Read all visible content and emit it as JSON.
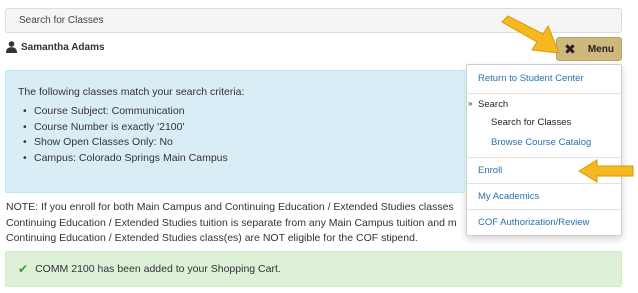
{
  "header": {
    "title": "Search for Classes"
  },
  "user": {
    "name": "Samantha Adams",
    "icon": "person-icon"
  },
  "menu_button": {
    "label": "Menu",
    "icon": "close-icon"
  },
  "dropdown": {
    "return_link": "Return to Student Center",
    "search_label": "Search",
    "search_marker": "»",
    "search_sub": [
      "Search for Classes",
      "Browse Course Catalog"
    ],
    "enroll": "Enroll",
    "my_academics": "My Academics",
    "cof": "COF Authorization/Review"
  },
  "criteria": {
    "intro": "The following classes match your search criteria:",
    "items": [
      "Course Subject: Communication",
      "Course Number is exactly '2100'",
      "Show Open Classes Only: No",
      "Campus: Colorado Springs Main Campus"
    ]
  },
  "note": {
    "lines": [
      "NOTE: If you enroll for both Main Campus and Continuing Education / Extended Studies classes",
      "Continuing Education / Extended Studies tuition is separate from any Main Campus tuition and m",
      "Continuing Education / Extended Studies class(es) are NOT eligible for the COF stipend."
    ]
  },
  "success": {
    "message": "COMM 2100 has been added to your Shopping Cart.",
    "icon": "checkmark-icon"
  },
  "colors": {
    "menu_button": "#cfb87c",
    "info_bg": "#d9edf7",
    "success_bg": "#dff0d8",
    "link": "#2a6fb0",
    "annotation_arrow": "#f5b820"
  }
}
